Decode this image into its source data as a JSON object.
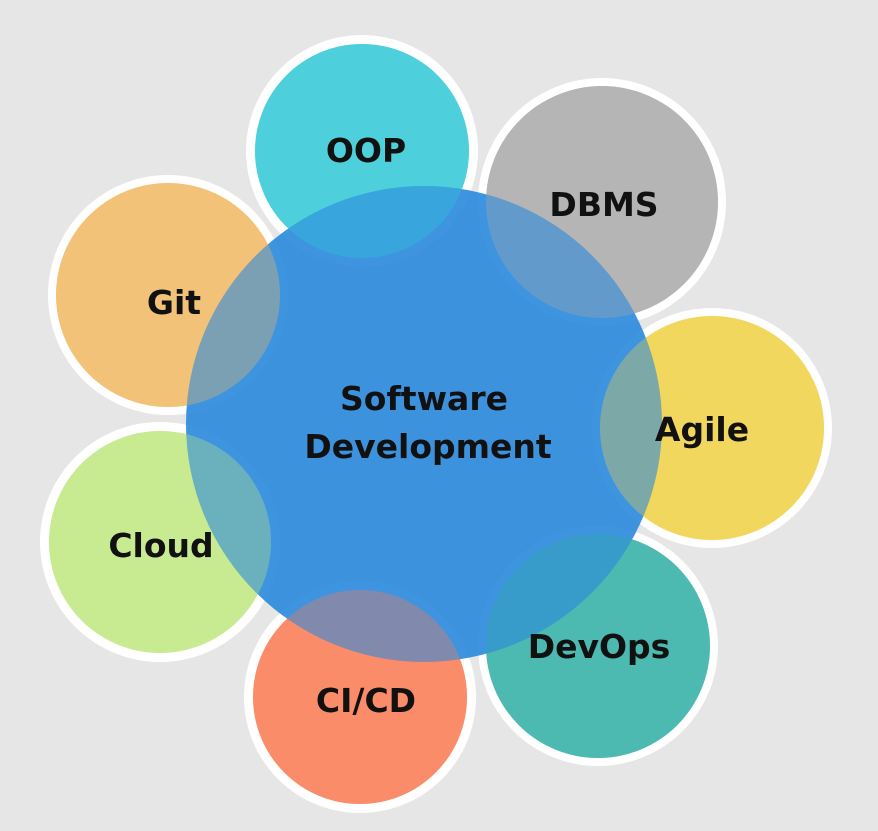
{
  "center": {
    "lines": [
      "Software",
      "Development"
    ],
    "color": "#2a88dd"
  },
  "topics": [
    {
      "label": "OOP",
      "color": "#4ecfdc"
    },
    {
      "label": "DBMS",
      "color": "#b5b5b5"
    },
    {
      "label": "Agile",
      "color": "#f1d85e"
    },
    {
      "label": "DevOps",
      "color": "#4dbab1"
    },
    {
      "label": "CI/CD",
      "color": "#fb8c6b"
    },
    {
      "label": "Cloud",
      "color": "#c8ec92"
    },
    {
      "label": "Git",
      "color": "#f2c277"
    }
  ],
  "background": "#e6e6e6"
}
